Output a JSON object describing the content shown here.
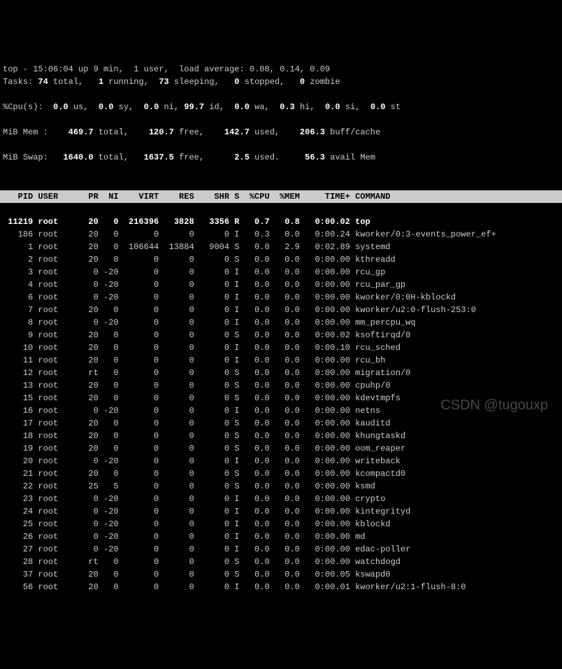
{
  "summary": {
    "line1_pre": "top - ",
    "time": "15:06:04",
    "line1_rest": " up 9 min,  1 user,  load average: 0.08, 0.14, 0.09",
    "tasks": {
      "total": "74",
      "running": "1",
      "sleeping": "73",
      "stopped": "0",
      "zombie": "0"
    },
    "cpu": {
      "us": "0.0",
      "sy": "0.0",
      "ni": "0.0",
      "id": "99.7",
      "wa": "0.0",
      "hi": "0.3",
      "si": "0.0",
      "st": "0.0"
    },
    "mem": {
      "total": "469.7",
      "free": "120.7",
      "used": "142.7",
      "buff": "206.3"
    },
    "swap": {
      "total": "1640.0",
      "free": "1637.5",
      "used": "2.5",
      "avail": "56.3"
    }
  },
  "columns": [
    "PID",
    "USER",
    "PR",
    "NI",
    "VIRT",
    "RES",
    "SHR",
    "S",
    "%CPU",
    "%MEM",
    "TIME+",
    "COMMAND"
  ],
  "processes": [
    {
      "pid": "11219",
      "user": "root",
      "pr": "20",
      "ni": "0",
      "virt": "216396",
      "res": "3828",
      "shr": "3356",
      "s": "R",
      "cpu": "0.7",
      "mem": "0.8",
      "time": "0:00.02",
      "cmd": "top"
    },
    {
      "pid": "186",
      "user": "root",
      "pr": "20",
      "ni": "0",
      "virt": "0",
      "res": "0",
      "shr": "0",
      "s": "I",
      "cpu": "0.3",
      "mem": "0.0",
      "time": "0:00.24",
      "cmd": "kworker/0:3-events_power_ef+"
    },
    {
      "pid": "1",
      "user": "root",
      "pr": "20",
      "ni": "0",
      "virt": "106644",
      "res": "13884",
      "shr": "9004",
      "s": "S",
      "cpu": "0.0",
      "mem": "2.9",
      "time": "0:02.89",
      "cmd": "systemd"
    },
    {
      "pid": "2",
      "user": "root",
      "pr": "20",
      "ni": "0",
      "virt": "0",
      "res": "0",
      "shr": "0",
      "s": "S",
      "cpu": "0.0",
      "mem": "0.0",
      "time": "0:00.00",
      "cmd": "kthreadd"
    },
    {
      "pid": "3",
      "user": "root",
      "pr": "0",
      "ni": "-20",
      "virt": "0",
      "res": "0",
      "shr": "0",
      "s": "I",
      "cpu": "0.0",
      "mem": "0.0",
      "time": "0:00.00",
      "cmd": "rcu_gp"
    },
    {
      "pid": "4",
      "user": "root",
      "pr": "0",
      "ni": "-20",
      "virt": "0",
      "res": "0",
      "shr": "0",
      "s": "I",
      "cpu": "0.0",
      "mem": "0.0",
      "time": "0:00.00",
      "cmd": "rcu_par_gp"
    },
    {
      "pid": "6",
      "user": "root",
      "pr": "0",
      "ni": "-20",
      "virt": "0",
      "res": "0",
      "shr": "0",
      "s": "I",
      "cpu": "0.0",
      "mem": "0.0",
      "time": "0:00.00",
      "cmd": "kworker/0:0H-kblockd"
    },
    {
      "pid": "7",
      "user": "root",
      "pr": "20",
      "ni": "0",
      "virt": "0",
      "res": "0",
      "shr": "0",
      "s": "I",
      "cpu": "0.0",
      "mem": "0.0",
      "time": "0:00.00",
      "cmd": "kworker/u2:0-flush-253:0"
    },
    {
      "pid": "8",
      "user": "root",
      "pr": "0",
      "ni": "-20",
      "virt": "0",
      "res": "0",
      "shr": "0",
      "s": "I",
      "cpu": "0.0",
      "mem": "0.0",
      "time": "0:00.00",
      "cmd": "mm_percpu_wq"
    },
    {
      "pid": "9",
      "user": "root",
      "pr": "20",
      "ni": "0",
      "virt": "0",
      "res": "0",
      "shr": "0",
      "s": "S",
      "cpu": "0.0",
      "mem": "0.0",
      "time": "0:00.02",
      "cmd": "ksoftirqd/0"
    },
    {
      "pid": "10",
      "user": "root",
      "pr": "20",
      "ni": "0",
      "virt": "0",
      "res": "0",
      "shr": "0",
      "s": "I",
      "cpu": "0.0",
      "mem": "0.0",
      "time": "0:00.10",
      "cmd": "rcu_sched"
    },
    {
      "pid": "11",
      "user": "root",
      "pr": "20",
      "ni": "0",
      "virt": "0",
      "res": "0",
      "shr": "0",
      "s": "I",
      "cpu": "0.0",
      "mem": "0.0",
      "time": "0:00.00",
      "cmd": "rcu_bh"
    },
    {
      "pid": "12",
      "user": "root",
      "pr": "rt",
      "ni": "0",
      "virt": "0",
      "res": "0",
      "shr": "0",
      "s": "S",
      "cpu": "0.0",
      "mem": "0.0",
      "time": "0:00.00",
      "cmd": "migration/0"
    },
    {
      "pid": "13",
      "user": "root",
      "pr": "20",
      "ni": "0",
      "virt": "0",
      "res": "0",
      "shr": "0",
      "s": "S",
      "cpu": "0.0",
      "mem": "0.0",
      "time": "0:00.00",
      "cmd": "cpuhp/0"
    },
    {
      "pid": "15",
      "user": "root",
      "pr": "20",
      "ni": "0",
      "virt": "0",
      "res": "0",
      "shr": "0",
      "s": "S",
      "cpu": "0.0",
      "mem": "0.0",
      "time": "0:00.00",
      "cmd": "kdevtmpfs"
    },
    {
      "pid": "16",
      "user": "root",
      "pr": "0",
      "ni": "-20",
      "virt": "0",
      "res": "0",
      "shr": "0",
      "s": "I",
      "cpu": "0.0",
      "mem": "0.0",
      "time": "0:00.00",
      "cmd": "netns"
    },
    {
      "pid": "17",
      "user": "root",
      "pr": "20",
      "ni": "0",
      "virt": "0",
      "res": "0",
      "shr": "0",
      "s": "S",
      "cpu": "0.0",
      "mem": "0.0",
      "time": "0:00.00",
      "cmd": "kauditd"
    },
    {
      "pid": "18",
      "user": "root",
      "pr": "20",
      "ni": "0",
      "virt": "0",
      "res": "0",
      "shr": "0",
      "s": "S",
      "cpu": "0.0",
      "mem": "0.0",
      "time": "0:00.00",
      "cmd": "khungtaskd"
    },
    {
      "pid": "19",
      "user": "root",
      "pr": "20",
      "ni": "0",
      "virt": "0",
      "res": "0",
      "shr": "0",
      "s": "S",
      "cpu": "0.0",
      "mem": "0.0",
      "time": "0:00.00",
      "cmd": "oom_reaper"
    },
    {
      "pid": "20",
      "user": "root",
      "pr": "0",
      "ni": "-20",
      "virt": "0",
      "res": "0",
      "shr": "0",
      "s": "I",
      "cpu": "0.0",
      "mem": "0.0",
      "time": "0:00.00",
      "cmd": "writeback"
    },
    {
      "pid": "21",
      "user": "root",
      "pr": "20",
      "ni": "0",
      "virt": "0",
      "res": "0",
      "shr": "0",
      "s": "S",
      "cpu": "0.0",
      "mem": "0.0",
      "time": "0:00.00",
      "cmd": "kcompactd0"
    },
    {
      "pid": "22",
      "user": "root",
      "pr": "25",
      "ni": "5",
      "virt": "0",
      "res": "0",
      "shr": "0",
      "s": "S",
      "cpu": "0.0",
      "mem": "0.0",
      "time": "0:00.00",
      "cmd": "ksmd"
    },
    {
      "pid": "23",
      "user": "root",
      "pr": "0",
      "ni": "-20",
      "virt": "0",
      "res": "0",
      "shr": "0",
      "s": "I",
      "cpu": "0.0",
      "mem": "0.0",
      "time": "0:00.00",
      "cmd": "crypto"
    },
    {
      "pid": "24",
      "user": "root",
      "pr": "0",
      "ni": "-20",
      "virt": "0",
      "res": "0",
      "shr": "0",
      "s": "I",
      "cpu": "0.0",
      "mem": "0.0",
      "time": "0:00.00",
      "cmd": "kintegrityd"
    },
    {
      "pid": "25",
      "user": "root",
      "pr": "0",
      "ni": "-20",
      "virt": "0",
      "res": "0",
      "shr": "0",
      "s": "I",
      "cpu": "0.0",
      "mem": "0.0",
      "time": "0:00.00",
      "cmd": "kblockd"
    },
    {
      "pid": "26",
      "user": "root",
      "pr": "0",
      "ni": "-20",
      "virt": "0",
      "res": "0",
      "shr": "0",
      "s": "I",
      "cpu": "0.0",
      "mem": "0.0",
      "time": "0:00.00",
      "cmd": "md"
    },
    {
      "pid": "27",
      "user": "root",
      "pr": "0",
      "ni": "-20",
      "virt": "0",
      "res": "0",
      "shr": "0",
      "s": "I",
      "cpu": "0.0",
      "mem": "0.0",
      "time": "0:00.00",
      "cmd": "edac-poller"
    },
    {
      "pid": "28",
      "user": "root",
      "pr": "rt",
      "ni": "0",
      "virt": "0",
      "res": "0",
      "shr": "0",
      "s": "S",
      "cpu": "0.0",
      "mem": "0.0",
      "time": "0:00.00",
      "cmd": "watchdogd"
    },
    {
      "pid": "37",
      "user": "root",
      "pr": "20",
      "ni": "0",
      "virt": "0",
      "res": "0",
      "shr": "0",
      "s": "S",
      "cpu": "0.0",
      "mem": "0.0",
      "time": "0:00.05",
      "cmd": "kswapd0"
    },
    {
      "pid": "56",
      "user": "root",
      "pr": "20",
      "ni": "0",
      "virt": "0",
      "res": "0",
      "shr": "0",
      "s": "I",
      "cpu": "0.0",
      "mem": "0.0",
      "time": "0:00.01",
      "cmd": "kworker/u2:1-flush-8:0"
    }
  ],
  "watermark": "CSDN @tugouxp"
}
